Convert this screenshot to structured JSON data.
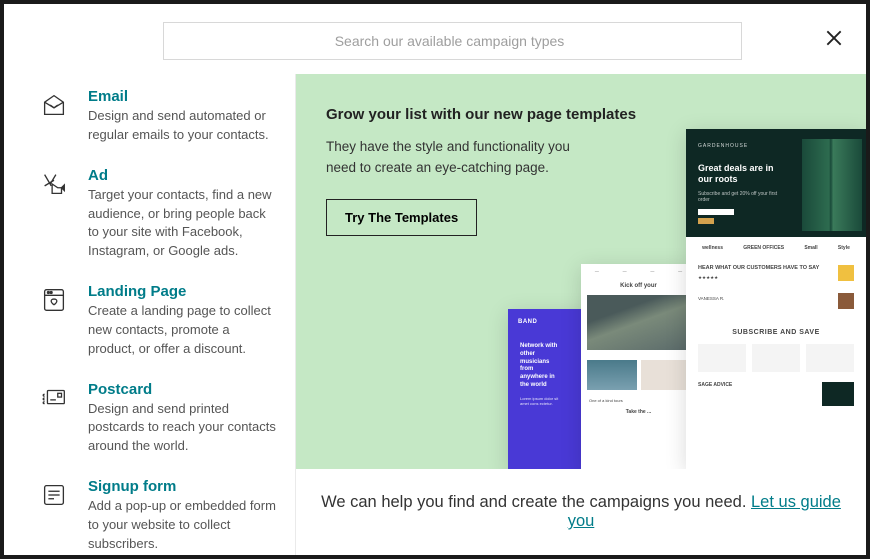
{
  "search": {
    "placeholder": "Search our available campaign types"
  },
  "sidebar": {
    "items": [
      {
        "title": "Email",
        "desc": "Design and send automated or regular emails to your contacts."
      },
      {
        "title": "Ad",
        "desc": "Target your contacts, find a new audience, or bring people back to your site with Facebook, Instagram, or Google ads."
      },
      {
        "title": "Landing Page",
        "desc": "Create a landing page to collect new contacts, promote a product, or offer a discount."
      },
      {
        "title": "Postcard",
        "desc": "Design and send printed postcards to reach your contacts around the world."
      },
      {
        "title": "Signup form",
        "desc": "Add a pop-up or embedded form to your website to collect subscribers."
      }
    ]
  },
  "hero": {
    "title": "Grow your list with our new page templates",
    "subtitle": "They have the style and functionality you need to create an eye-catching page.",
    "button": "Try The Templates"
  },
  "mockups": {
    "a": {
      "brand": "GARDENHOUSE",
      "headline": "Great deals are in our roots",
      "sub": "Subscribe and get 20% off your first order",
      "logos": [
        "wellness",
        "GREEN OFFICES",
        "Small",
        "Style"
      ],
      "testimonial_title": "HEAR WHAT OUR CUSTOMERS HAVE TO SAY",
      "testimonial_name": "VANESSA R.",
      "subscribe": "SUBSCRIBE AND SAVE",
      "sage": "SAGE ADVICE"
    },
    "b": {
      "title": "Kick off your",
      "take": "Take the ..."
    },
    "c": {
      "brand": "BAND",
      "tag": "Network with other musicians from anywhere in the world"
    }
  },
  "footer": {
    "text": "We can help you find and create the campaigns you need. ",
    "link": "Let us guide you"
  }
}
